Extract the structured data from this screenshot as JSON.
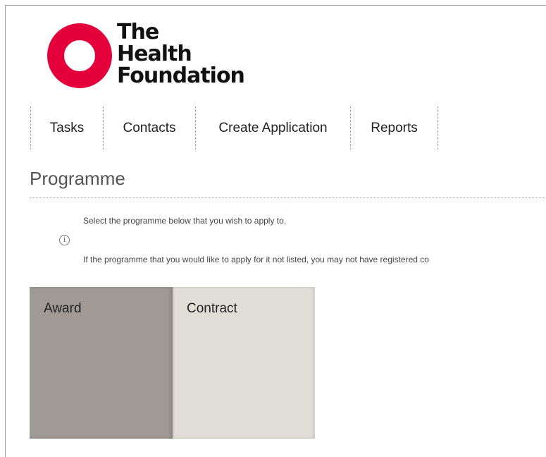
{
  "logo": {
    "line1": "The",
    "line2": "Health",
    "line3": "Foundation",
    "brand_color": "#e4003b"
  },
  "nav": {
    "items": [
      {
        "label": "Tasks"
      },
      {
        "label": "Contacts"
      },
      {
        "label": "Create Application"
      },
      {
        "label": "Reports"
      }
    ]
  },
  "page": {
    "title": "Programme"
  },
  "info": {
    "icon": "info-icon",
    "line1": "Select the programme below that you wish to apply to.",
    "line2": "If the programme that you would like to apply for it not listed, you may not have registered co"
  },
  "tiles": [
    {
      "label": "Award",
      "color": "#9f9a94"
    },
    {
      "label": "Contract",
      "color": "#e1ddd7"
    }
  ]
}
